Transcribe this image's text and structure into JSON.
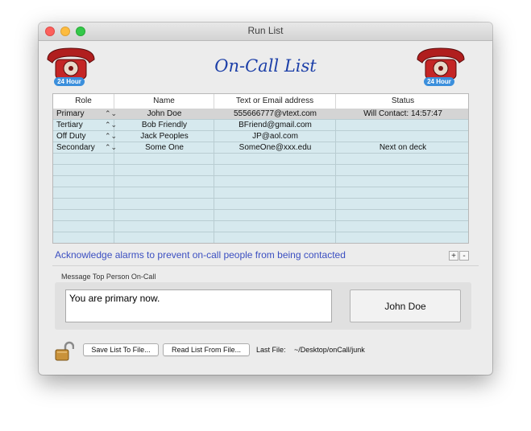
{
  "window": {
    "title": "Run List"
  },
  "header": {
    "title": "On-Call List",
    "badge_left": "24 Hour",
    "badge_right": "24 Hour"
  },
  "table": {
    "columns": [
      "Role",
      "Name",
      "Text or Email address",
      "Status"
    ],
    "rows": [
      {
        "role": "Primary",
        "name": "John Doe",
        "address": "555666777@vtext.com",
        "status": "Will Contact: 14:57:47"
      },
      {
        "role": "Tertiary",
        "name": "Bob Friendly",
        "address": "BFriend@gmail.com",
        "status": ""
      },
      {
        "role": "Off Duty",
        "name": "Jack Peoples",
        "address": "JP@aol.com",
        "status": ""
      },
      {
        "role": "Secondary",
        "name": "Some One",
        "address": "SomeOne@xxx.edu",
        "status": "Next on deck"
      }
    ]
  },
  "ack": {
    "text": "Acknowledge alarms to prevent on-call people from being contacted",
    "plus": "+",
    "minus": "-"
  },
  "message": {
    "label": "Message Top Person On-Call",
    "text": "You are primary now.",
    "button": "John Doe"
  },
  "footer": {
    "save": "Save List To File...",
    "read": "Read List From File...",
    "last_file_label": "Last File:",
    "last_file_path": "~/Desktop/onCall/junk"
  }
}
